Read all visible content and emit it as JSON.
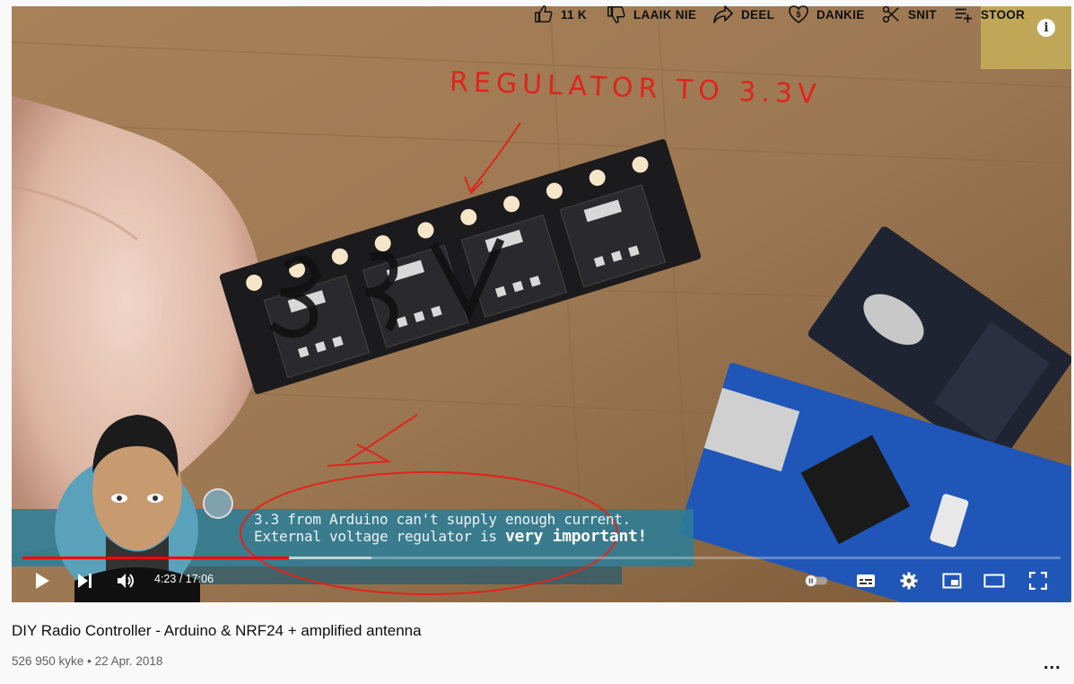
{
  "video": {
    "overlay_text": "REGULATOR TO 3.3V",
    "caption_line1": "3.3 from Arduino can't supply enough current.",
    "caption_line2_prefix": "External voltage regulator is",
    "caption_line2_emph": "very important!",
    "chip_label": "3.3V"
  },
  "player": {
    "current_time": "4:23",
    "duration": "17:06",
    "time_separator": " / ",
    "played_fraction": 0.257,
    "loaded_fraction": 0.336,
    "autoplay_on": false,
    "info_label": "i"
  },
  "title": "DIY Radio Controller - Arduino & NRF24 + amplified antenna",
  "views": "526 950 kyke",
  "dot": "•",
  "date": "22 Apr. 2018",
  "actions": {
    "like_count": "11 K",
    "dislike_label": "LAAIK NIE",
    "share_label": "DEEL",
    "thanks_label": "DANKIE",
    "clip_label": "SNIT",
    "save_label": "STOOR",
    "more_label": "..."
  },
  "colors": {
    "accent": "#ff0000",
    "annotation": "#e0241e",
    "text": "#0f0f0f",
    "meta": "#606060"
  }
}
